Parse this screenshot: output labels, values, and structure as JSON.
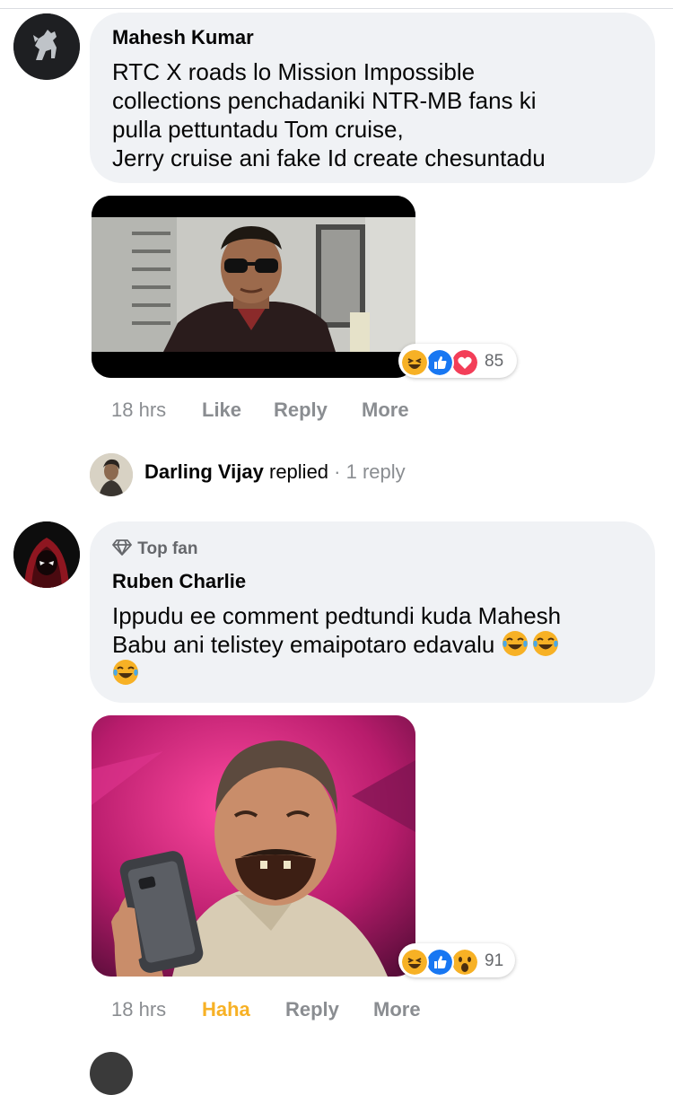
{
  "comments": [
    {
      "author": "Mahesh Kumar",
      "text_lines": [
        "RTC X roads lo Mission Impossible",
        "collections penchadaniki NTR-MB fans ki",
        "pulla pettuntadu Tom cruise,",
        "Jerry cruise ani fake Id create chesuntadu"
      ],
      "reaction_icons": [
        "haha-icon",
        "like-icon",
        "love-icon"
      ],
      "reaction_count": "85",
      "time": "18 hrs",
      "like_label": "Like",
      "reply_label": "Reply",
      "more_label": "More"
    },
    {
      "badge": "Top fan",
      "author": "Ruben Charlie",
      "text_line1": "Ippudu ee comment pedtundi kuda Mahesh",
      "text_line2": "Babu ani telistey emaipotaro edavalu",
      "reaction_icons": [
        "haha-icon",
        "like-icon",
        "wow-icon"
      ],
      "reaction_count": "91",
      "time": "18 hrs",
      "like_label": "Haha",
      "reply_label": "Reply",
      "more_label": "More"
    }
  ],
  "reply_summary": {
    "name": "Darling Vijay",
    "action": "replied",
    "separator": "·",
    "count_label": "1 reply"
  },
  "colors": {
    "bubble": "#f0f2f5",
    "meta_text": "#8a8d91",
    "haha_active": "#f7b125",
    "like_blue": "#1877f2",
    "love_red": "#f33e58",
    "emoji_yellow": "#f7b125"
  }
}
